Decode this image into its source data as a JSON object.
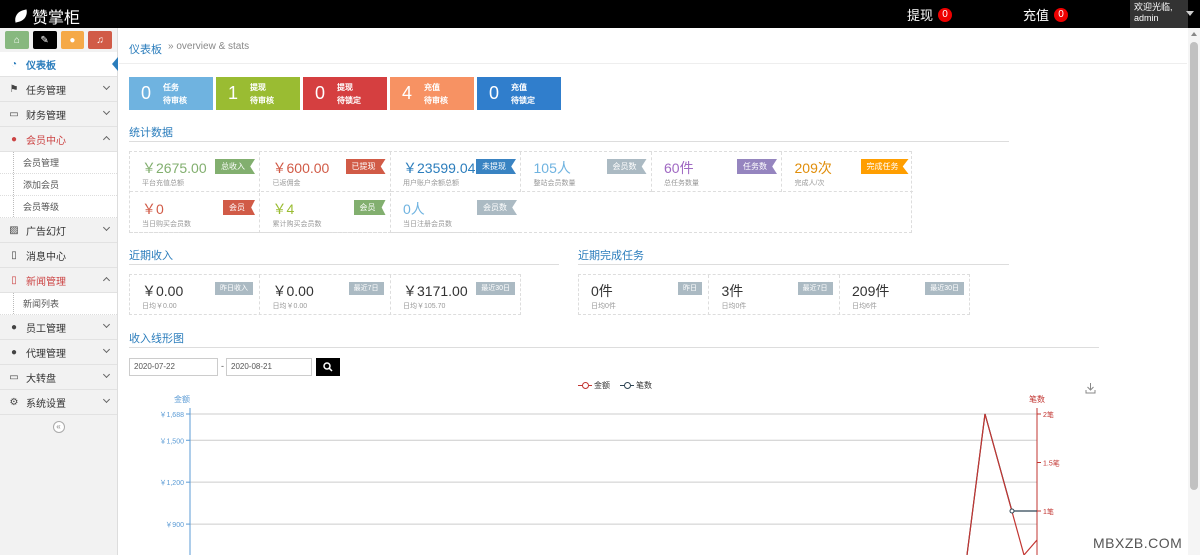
{
  "navbar": {
    "brand": "赞掌柜",
    "withdraw_label": "提现",
    "withdraw_count": "0",
    "recharge_label": "充值",
    "recharge_count": "0",
    "welcome": "欢迎光临,",
    "username": "admin"
  },
  "sidebar": {
    "shortcut_colors": [
      "#87b87f",
      "#000000",
      "#f5a947",
      "#d15b47"
    ],
    "items": [
      {
        "label": "仪表板",
        "icon": "dashboard-icon"
      },
      {
        "label": "任务管理",
        "icon": "flag-icon"
      },
      {
        "label": "财务管理",
        "icon": "hdd-icon"
      },
      {
        "label": "会员中心",
        "icon": "user-icon"
      },
      {
        "label": "会员管理"
      },
      {
        "label": "添加会员"
      },
      {
        "label": "会员等级"
      },
      {
        "label": "广告幻灯",
        "icon": "picture-icon"
      },
      {
        "label": "消息中心",
        "icon": "bookmark-icon"
      },
      {
        "label": "新闻管理",
        "icon": "bookmark-icon"
      },
      {
        "label": "新闻列表"
      },
      {
        "label": "员工管理",
        "icon": "user-icon"
      },
      {
        "label": "代理管理",
        "icon": "user-icon"
      },
      {
        "label": "大转盘",
        "icon": "hdd-icon"
      },
      {
        "label": "系统设置",
        "icon": "cog-icon"
      }
    ],
    "collapse_glyph": "«"
  },
  "breadcrumb": {
    "title": "仪表板",
    "sub": "» overview & stats"
  },
  "top_stats": [
    {
      "num": "0",
      "line1": "任务",
      "line2": "待审核",
      "color": "#6fb3e0"
    },
    {
      "num": "1",
      "line1": "提现",
      "line2": "待审核",
      "color": "#9abc32"
    },
    {
      "num": "0",
      "line1": "提现",
      "line2": "待锁定",
      "color": "#d53f40"
    },
    {
      "num": "4",
      "line1": "充值",
      "line2": "待审核",
      "color": "#f79263"
    },
    {
      "num": "0",
      "line1": "充值",
      "line2": "待锁定",
      "color": "#307ecc"
    }
  ],
  "sections": {
    "stats": "统计数据",
    "recent_income": "近期收入",
    "recent_tasks": "近期完成任务",
    "income_chart": "收入线形图"
  },
  "stats_cards": [
    {
      "value": "￥2675.00",
      "sub": "平台充值总额",
      "tag": "总收入",
      "color": "#82af6f",
      "tag_color": "#82af6f"
    },
    {
      "value": "￥600.00",
      "sub": "已返佣金",
      "tag": "已提现",
      "color": "#d15b47",
      "tag_color": "#d15b47"
    },
    {
      "value": "￥23599.04",
      "sub": "用户账户余额总额",
      "tag": "未提现",
      "color": "#2b7dbc",
      "tag_color": "#3983c2"
    },
    {
      "value": "105人",
      "sub": "整站会员数量",
      "tag": "会员数",
      "color": "#6fb3e0",
      "tag_color": "#abbac3"
    },
    {
      "value": "60件",
      "sub": "总任务数量",
      "tag": "任务数",
      "color": "#a069c3",
      "tag_color": "#9585bf"
    },
    {
      "value": "209次",
      "sub": "完成人/次",
      "tag": "完成任务",
      "color": "#e08e0b",
      "tag_color": "#ff9e00"
    },
    {
      "value": "￥0",
      "sub": "当日购买会员数",
      "tag": "会员",
      "color": "#d15b47",
      "tag_color": "#d15b47"
    },
    {
      "value": "￥4",
      "sub": "累计购买会员数",
      "tag": "会员",
      "color": "#9abc32",
      "tag_color": "#82af6f"
    },
    {
      "value": "0人",
      "sub": "当日注册会员数",
      "tag": "会员数",
      "color": "#6fb3e0",
      "tag_color": "#abbac3"
    }
  ],
  "income_cards": [
    {
      "value": "￥0.00",
      "sub": "日均￥0.00",
      "tag": "昨日收入"
    },
    {
      "value": "￥0.00",
      "sub": "日均￥0.00",
      "tag": "最近7日"
    },
    {
      "value": "￥3171.00",
      "sub": "日均￥105.70",
      "tag": "最近30日"
    }
  ],
  "task_cards": [
    {
      "value": "0件",
      "sub": "日均0件",
      "tag": "昨日"
    },
    {
      "value": "3件",
      "sub": "日均0件",
      "tag": "最近7日"
    },
    {
      "value": "209件",
      "sub": "日均6件",
      "tag": "最近30日"
    }
  ],
  "date_range": {
    "start": "2020-07-22",
    "separator": "-",
    "end": "2020-08-21"
  },
  "chart_data": {
    "type": "line",
    "legend": [
      "金额",
      "笔数"
    ],
    "series": [
      {
        "name": "金额",
        "color": "#c23531",
        "axis": "left"
      },
      {
        "name": "笔数",
        "color": "#2f4554",
        "axis": "right"
      }
    ],
    "left_axis": {
      "label": "金额",
      "ticks": [
        "￥1,688",
        "￥1,500",
        "￥1,200",
        "￥900",
        "￥600"
      ],
      "tick_values": [
        1688,
        1500,
        1200,
        900,
        600
      ],
      "color": "#5b9bd5"
    },
    "right_axis": {
      "label": "笔数",
      "ticks": [
        "2笔",
        "1.5笔",
        "1笔"
      ],
      "tick_values": [
        2,
        1.5,
        1
      ],
      "color": "#c23531"
    }
  },
  "watermark": "MBXZB.COM"
}
